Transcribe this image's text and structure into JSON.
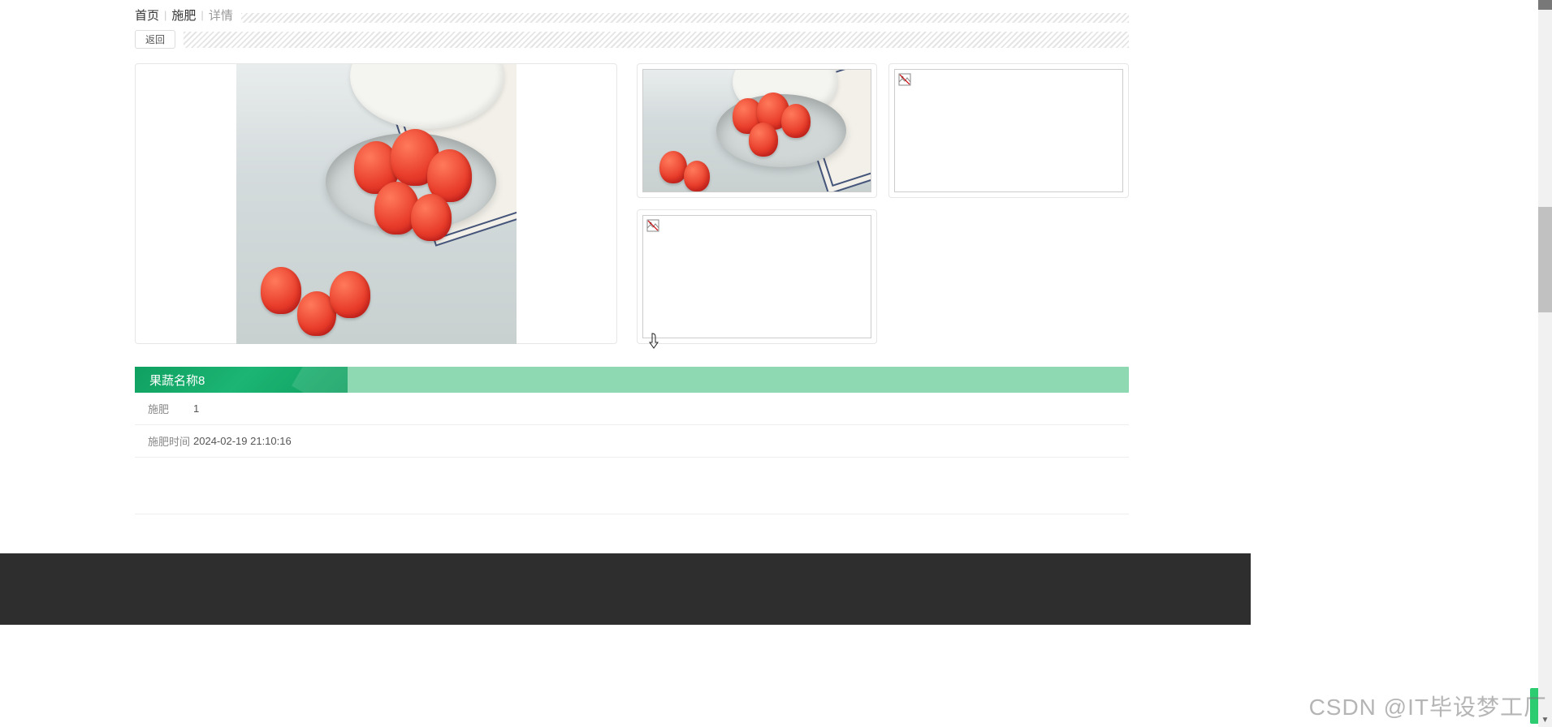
{
  "breadcrumb": {
    "home": "首页",
    "section": "施肥",
    "current": "详情"
  },
  "back_button": "返回",
  "title": "果蔬名称8",
  "details": [
    {
      "label": "施肥",
      "value": "1"
    },
    {
      "label": "施肥时间",
      "value": "2024-02-19 21:10:16"
    }
  ],
  "thumbnails": [
    {
      "has_image": true
    },
    {
      "has_image": false
    },
    {
      "has_image": false
    }
  ],
  "watermark": "CSDN @IT毕设梦工厂",
  "icons": {
    "broken_image": "broken-image-icon"
  }
}
